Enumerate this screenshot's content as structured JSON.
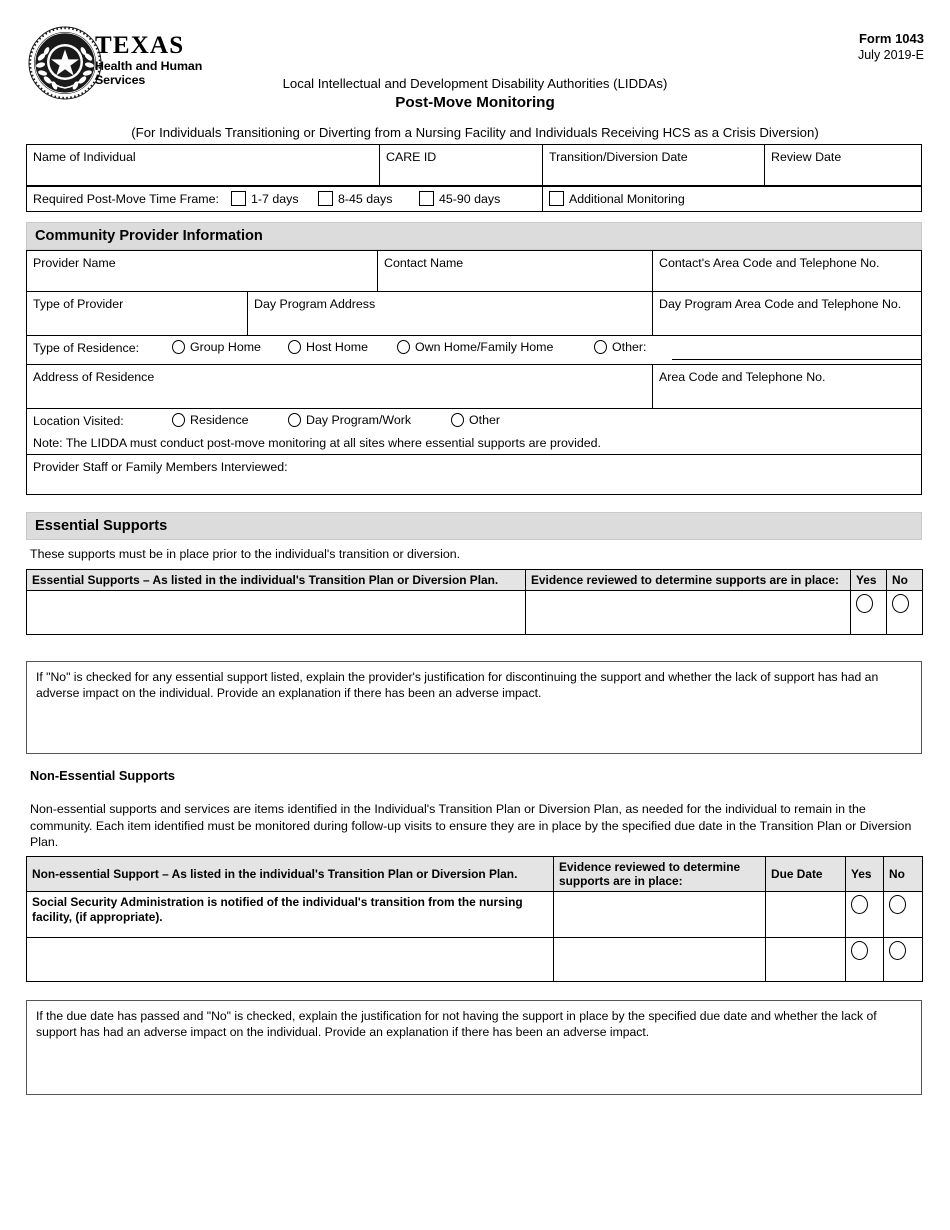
{
  "header": {
    "agency_name": "TEXAS",
    "agency_sub_line1": "Health and Human",
    "agency_sub_line2": "Services",
    "form_number": "Form 1043",
    "form_date": "July 2019-E",
    "subtitle": "Local Intellectual and Development Disability Authorities (LIDDAs)",
    "title": "Post-Move Monitoring",
    "scope": "(For Individuals Transitioning or Diverting from a Nursing Facility and Individuals Receiving HCS as a Crisis Diversion)"
  },
  "identification": {
    "name_of_individual": "Name of Individual",
    "care_id": "CARE ID",
    "transition_date": "Transition/Diversion Date",
    "review_date": "Review Date",
    "time_frame_label": "Required Post-Move Time Frame:",
    "time_frame_options": [
      "1-7 days",
      "8-45 days",
      "45-90 days"
    ],
    "additional_monitoring": "Additional Monitoring"
  },
  "provider": {
    "section_title": "Community Provider Information",
    "provider_name": "Provider Name",
    "contact_name": "Contact Name",
    "contact_phone": "Contact's Area Code and Telephone No.",
    "type_of_provider": "Type of Provider",
    "day_program_address": "Day Program Address",
    "day_program_phone": "Day Program  Area Code and Telephone No.",
    "type_of_residence_label": "Type of Residence:",
    "residence_options": [
      "Group Home",
      "Host Home",
      "Own Home/Family Home",
      "Other:"
    ],
    "address_of_residence": "Address of Residence",
    "residence_phone": "Area Code and Telephone No.",
    "location_visited_label": "Location Visited:",
    "location_options": [
      "Residence",
      "Day Program/Work",
      "Other"
    ],
    "note": "Note: The LIDDA must conduct post-move monitoring at all sites where essential supports are provided.",
    "staff_interviewed": "Provider Staff or Family Members Interviewed:"
  },
  "essential": {
    "section_title": "Essential Supports",
    "intro": "These supports must be in place prior to the individual's transition or diversion.",
    "columns": [
      "Essential Supports – As listed in the individual's Transition Plan or Diversion Plan.",
      "Evidence reviewed to determine supports are in place:",
      "Yes",
      "No"
    ],
    "rows": [
      {
        "support": "",
        "evidence": ""
      }
    ],
    "explanation": "If \"No\" is checked for any essential support listed, explain the provider's justification for discontinuing the support and whether the lack of support has had an adverse impact on the individual. Provide an explanation if there has been an adverse impact."
  },
  "nonessential": {
    "section_title": "Non-Essential Supports",
    "intro": "Non-essential supports and services are items identified in the Individual's Transition Plan or Diversion Plan, as needed for the individual to remain in the community. Each item identified must be monitored during follow-up visits to ensure they are in place by the specified due date in the Transition Plan or Diversion Plan.",
    "columns": [
      "Non-essential Support – As listed in the individual's Transition Plan or Diversion Plan.",
      "Evidence reviewed to determine supports are in place:",
      "Due Date",
      "Yes",
      "No"
    ],
    "rows": [
      {
        "support": "Social Security Administration is notified of the individual's transition from the nursing facility, (if appropriate).",
        "evidence": "",
        "due_date": ""
      },
      {
        "support": "",
        "evidence": "",
        "due_date": ""
      }
    ],
    "explanation": "If the due date has passed and \"No\" is checked, explain the justification for not having the support in place by the specified due date and whether the lack of support has had an adverse impact on the individual. Provide an explanation if there has been an adverse impact."
  },
  "colors": {
    "band_gray": "#dcdcdc",
    "table_header_gray": "#e4e4e4",
    "rule": "#000000"
  }
}
